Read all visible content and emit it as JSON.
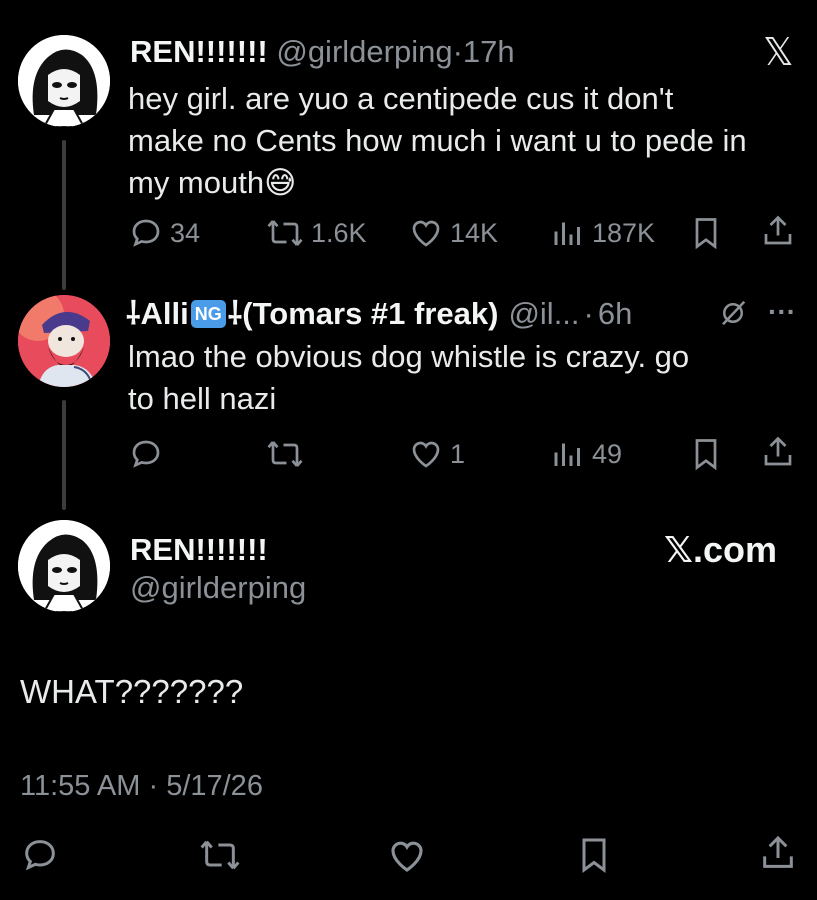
{
  "tweet1": {
    "name": "REN!!!!!!!",
    "handle": "@girlderping",
    "dot": "·",
    "time": "17h",
    "text": "hey girl.  are yuo a centipede  cus it don't make no Cents how much i want u to pede in my mouth",
    "emoji": "😅",
    "line1": "hey girl.  are yuo a centipede  cus it don't",
    "line2": "make no Cents how much i want u to pede in",
    "line3": "my mouth",
    "replies": "34",
    "reposts": "1.6K",
    "likes": "14K",
    "views": "187K",
    "logo": "𝕏"
  },
  "tweet2": {
    "name_prefix": "⸸Alli",
    "ng_badge": "NG",
    "name_suffix": "⸸(Tomars #1 freak)",
    "handle": "@il...",
    "dot": "·",
    "time": "6h",
    "line1": "lmao the obvious dog whistle is crazy. go",
    "line2": "to hell nazi",
    "likes": "1",
    "views": "49",
    "more": "···"
  },
  "tweet3": {
    "name": "REN!!!!!!!",
    "handle": "@girlderping",
    "site": "𝕏.com",
    "text": "WHAT???????",
    "time": "11:55 AM",
    "dot": "·",
    "date": "5/17/26"
  },
  "colors": {
    "background": "#000000",
    "text": "#e7e9ea",
    "muted": "#8b9197",
    "thread_line": "#3a3d40"
  }
}
